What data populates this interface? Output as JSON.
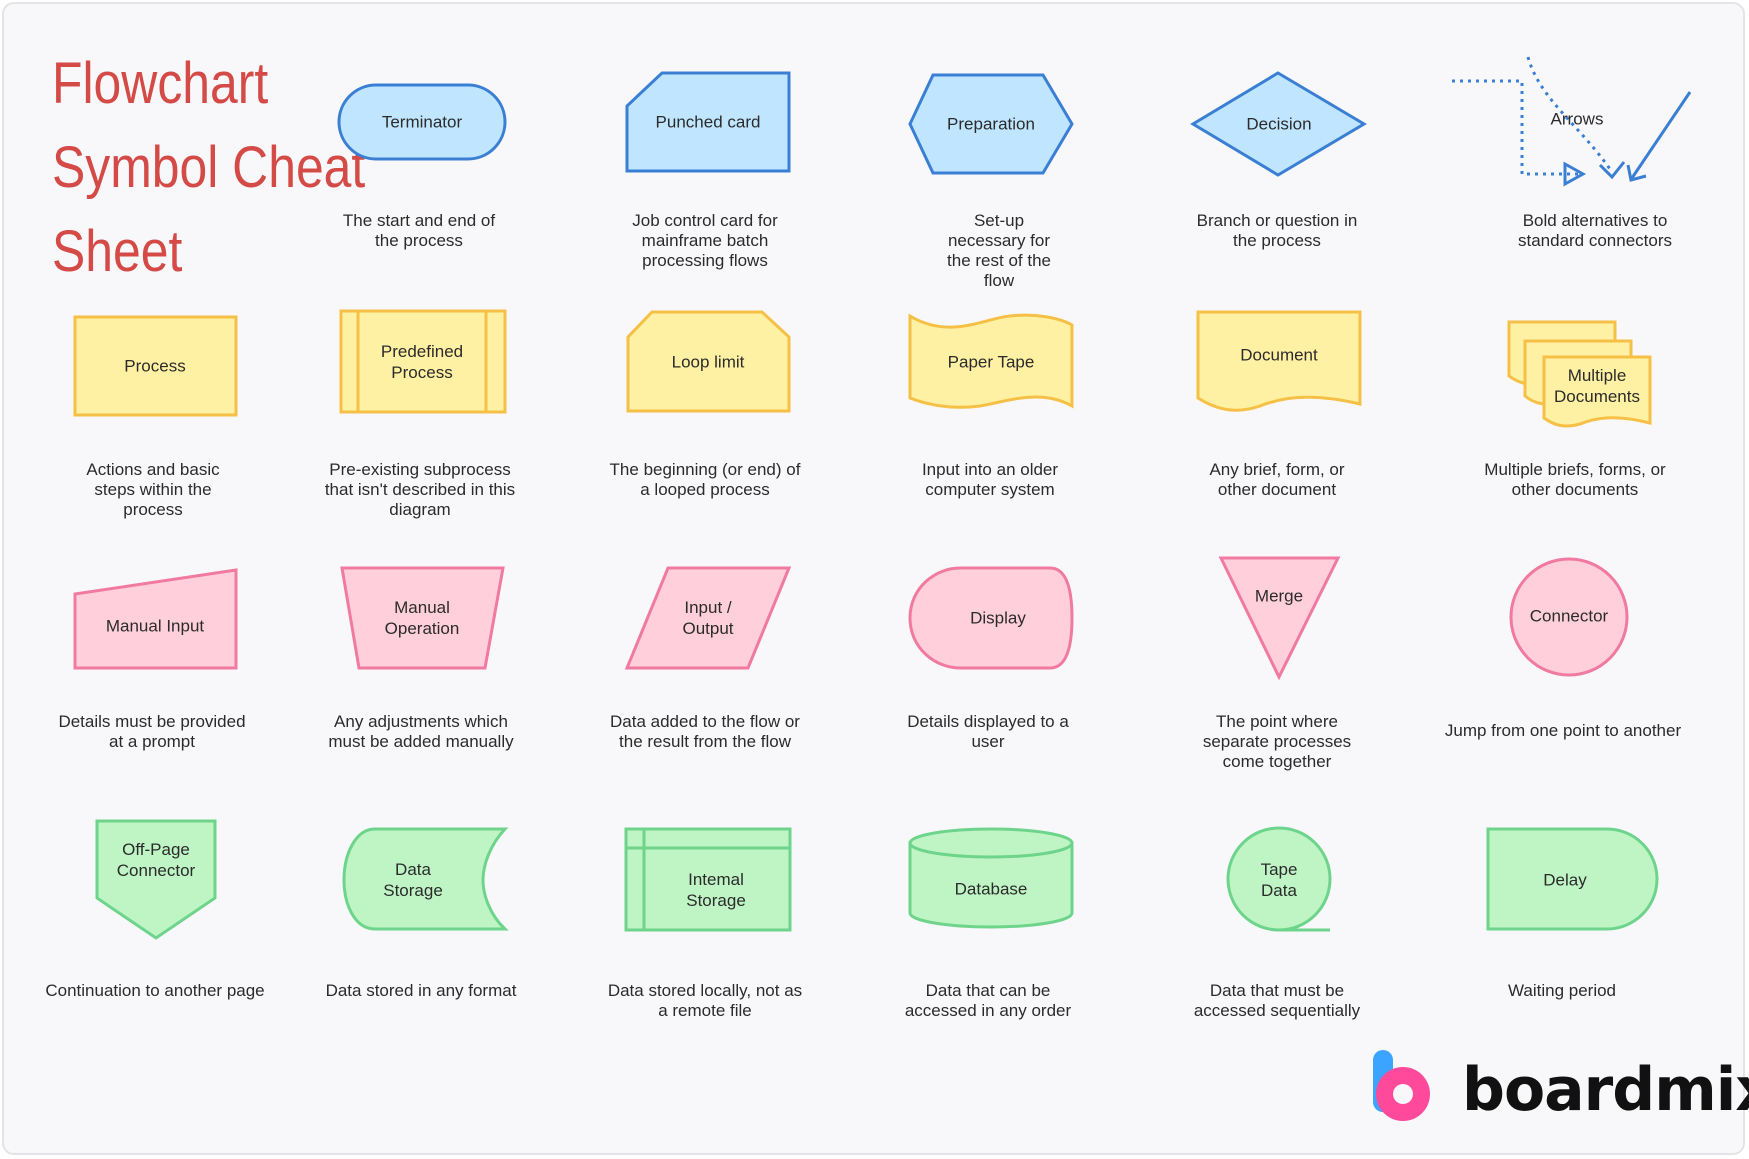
{
  "title_lines": [
    "Flowchart",
    "Symbol Cheat",
    "Sheet"
  ],
  "colors": {
    "blue_fill": "#c0e6ff",
    "blue_stroke": "#3b7fd4",
    "yellow_fill": "#fff1a4",
    "yellow_stroke": "#f5c045",
    "pink_fill": "#ffd0dc",
    "pink_stroke": "#f07aa0",
    "green_fill": "#bff5c5",
    "green_stroke": "#6ed48b",
    "title": "#d44a47"
  },
  "symbols": [
    {
      "id": "terminator",
      "label": "Terminator",
      "desc": "The start and end of\nthe process"
    },
    {
      "id": "punched-card",
      "label": "Punched card",
      "desc": "Job control card for\nmainframe batch\nprocessing flows"
    },
    {
      "id": "preparation",
      "label": "Preparation",
      "desc": "Set-up\nnecessary for\nthe rest of the\nflow"
    },
    {
      "id": "decision",
      "label": "Decision",
      "desc": "Branch or question in\nthe process"
    },
    {
      "id": "arrows",
      "label": "Arrows",
      "desc": "Bold alternatives to\nstandard connectors"
    },
    {
      "id": "process",
      "label": "Process",
      "desc": "Actions and basic\nsteps within the\nprocess"
    },
    {
      "id": "predefined-process",
      "label": "Predefined\nProcess",
      "desc": "Pre-existing subprocess\nthat isn't described in this\ndiagram"
    },
    {
      "id": "loop-limit",
      "label": "Loop limit",
      "desc": "The beginning (or end) of\na looped process"
    },
    {
      "id": "paper-tape",
      "label": "Paper Tape",
      "desc": "Input into an older\ncomputer system"
    },
    {
      "id": "document",
      "label": "Document",
      "desc": "Any brief, form, or\nother document"
    },
    {
      "id": "multiple-documents",
      "label": "Multiple\nDocuments",
      "desc": "Multiple briefs, forms, or\nother documents"
    },
    {
      "id": "manual-input",
      "label": "Manual Input",
      "desc": "Details must be provided\nat a prompt"
    },
    {
      "id": "manual-operation",
      "label": "Manual\nOperation",
      "desc": "Any adjustments which\nmust be added manually"
    },
    {
      "id": "input-output",
      "label": "Input /\nOutput",
      "desc": "Data added to the flow or\nthe result from the flow"
    },
    {
      "id": "display",
      "label": "Display",
      "desc": "Details displayed to a\nuser"
    },
    {
      "id": "merge",
      "label": "Merge",
      "desc": "The point where\nseparate processes\ncome together"
    },
    {
      "id": "connector",
      "label": "Connector",
      "desc": "Jump from one point to another"
    },
    {
      "id": "off-page-connector",
      "label": "Off-Page\nConnector",
      "desc": "Continuation to another page"
    },
    {
      "id": "data-storage",
      "label": "Data\nStorage",
      "desc": "Data stored in any format"
    },
    {
      "id": "internal-storage",
      "label": "Intemal\nStorage",
      "desc": "Data stored locally, not as\na remote file"
    },
    {
      "id": "database",
      "label": "Database",
      "desc": "Data that can be\naccessed in any order"
    },
    {
      "id": "tape-data",
      "label": "Tape\nData",
      "desc": "Data that must be\naccessed sequentially"
    },
    {
      "id": "delay",
      "label": "Delay",
      "desc": "Waiting period"
    }
  ],
  "brand": {
    "name": "boardmix",
    "logo_icon": "boardmix-logo-icon"
  }
}
